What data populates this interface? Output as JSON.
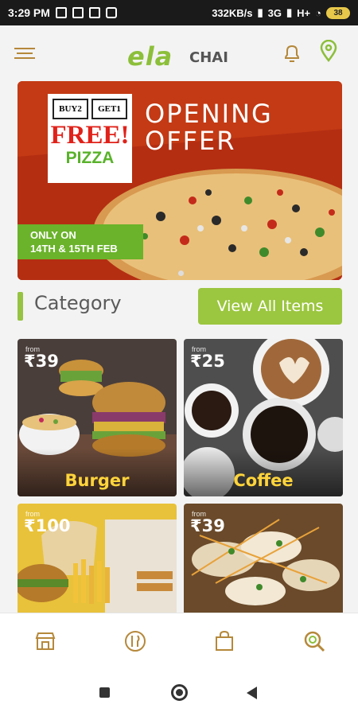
{
  "status_bar": {
    "time": "3:29 PM",
    "network_speed": "332KB/s",
    "network_types": [
      "3G",
      "H+"
    ],
    "battery": "38"
  },
  "header": {
    "logo_main": "ela",
    "logo_sub": "CHAI"
  },
  "banner": {
    "buy_label": "BUY",
    "buy_qty": "2",
    "get_label": "GET",
    "get_qty": "1",
    "free_text": "FREE!",
    "pizza_text": "PIZZA",
    "offer_line1": "OPENING",
    "offer_line2": "OFFER",
    "dates_line1": "ONLY ON",
    "dates_line2": "14th & 15th FEB"
  },
  "category": {
    "title": "Category",
    "view_all_label": "View All Items"
  },
  "cards": [
    {
      "from": "from",
      "price": "₹39",
      "name": "Burger"
    },
    {
      "from": "from",
      "price": "₹25",
      "name": "Coffee"
    },
    {
      "from": "from",
      "price": "₹100",
      "name": ""
    },
    {
      "from": "from",
      "price": "₹39",
      "name": ""
    }
  ],
  "bottom_nav": [
    {
      "icon": "store-icon"
    },
    {
      "icon": "food-icon"
    },
    {
      "icon": "shopping-bag-icon"
    },
    {
      "icon": "search-icon"
    }
  ],
  "colors": {
    "accent_green": "#9bc63f",
    "brand_brown": "#b5883a",
    "price_yellow": "#ffd43b",
    "banner_red": "#c23a14"
  }
}
